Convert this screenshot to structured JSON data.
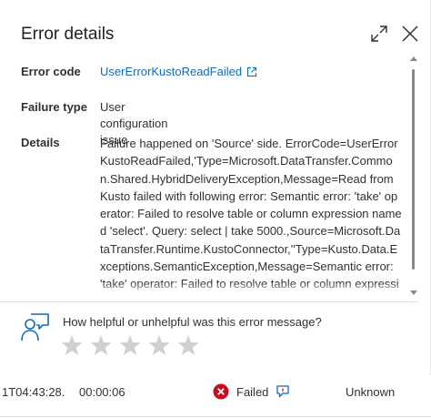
{
  "panel": {
    "title": "Error details"
  },
  "fields": {
    "error_code_label": "Error code",
    "error_code_value": "UserErrorKustoReadFailed",
    "failure_type_label": "Failure type",
    "failure_type_value": "User configuration issue",
    "details_label": "Details",
    "details_value": "Failure happened on 'Source' side. ErrorCode=UserErrorKustoReadFailed,'Type=Microsoft.DataTransfer.Common.Shared.HybridDeliveryException,Message=Read from Kusto failed with following error: Semantic error: 'take' operator: Failed to resolve table or column expression named 'select'. Query: select | take 5000.,Source=Microsoft.DataTransfer.Runtime.KustoConnector,''Type=Kusto.Data.Exceptions.SemanticException,Message=Semantic error: 'take' operator: Failed to resolve table or column expression named"
  },
  "feedback": {
    "question": "How helpful or unhelpful was this error message?",
    "max_stars": 5,
    "rating": 0
  },
  "run_row": {
    "time": "1T04:43:28.",
    "duration": "00:00:06",
    "status": "Failed",
    "extra": "Unknown"
  },
  "colors": {
    "link": "#0f6cbd",
    "error_red": "#c50f1f",
    "star_empty": "#d2d0ce",
    "feedback_blue": "#0f6cbd"
  },
  "icons": {
    "expand": "expand-icon",
    "close": "close-icon",
    "external_link": "external-link-icon",
    "feedback": "feedback-person-icon",
    "star": "star-icon",
    "error": "error-circle-icon",
    "chat": "chat-bubble-icon"
  }
}
